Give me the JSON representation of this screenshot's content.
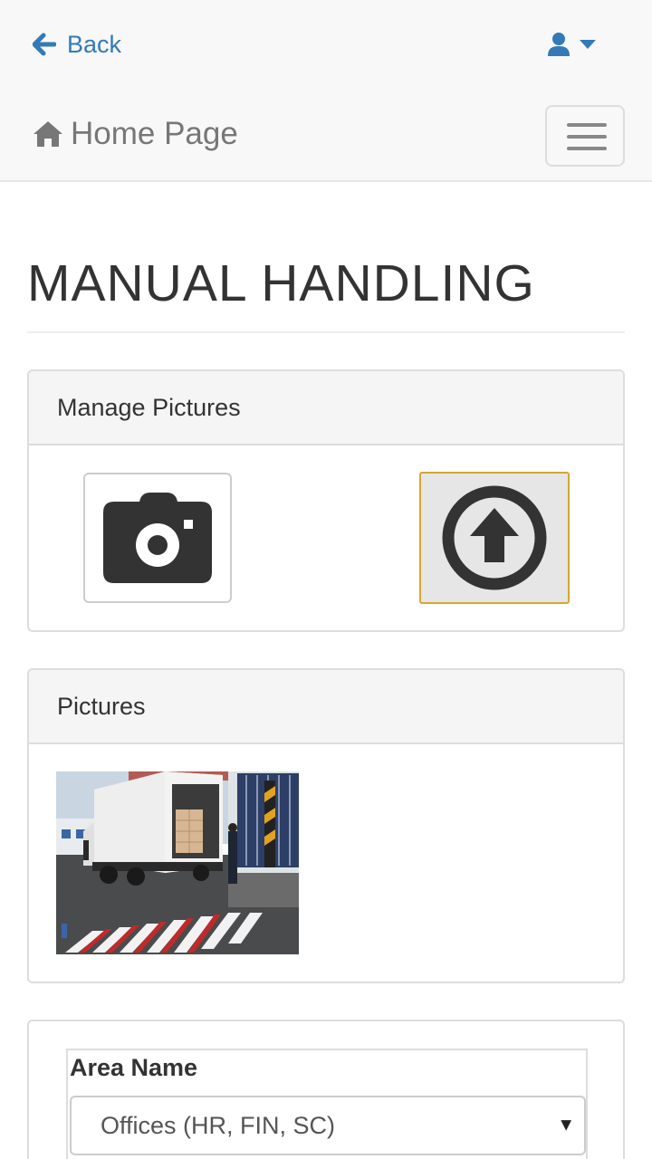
{
  "nav": {
    "back_label": "Back",
    "brand_label": "Home Page"
  },
  "page": {
    "title": "MANUAL HANDLING"
  },
  "manage_panel": {
    "heading": "Manage Pictures"
  },
  "pictures_panel": {
    "heading": "Pictures"
  },
  "form": {
    "area_label": "Area Name",
    "area_value": "Offices (HR, FIN, SC)"
  },
  "icons": {
    "back": "arrow-left-icon",
    "user": "user-icon",
    "caret": "caret-down-icon",
    "home": "home-icon",
    "menu": "hamburger-icon",
    "camera": "camera-icon",
    "upload": "arrow-circle-up-icon",
    "select_arrow": "triangle-down-icon"
  },
  "colors": {
    "link": "#337ab7",
    "navbar_bg": "#f8f8f8",
    "panel_heading_bg": "#f5f5f5",
    "upload_border": "#d4a731",
    "icon_dark": "#333333"
  }
}
